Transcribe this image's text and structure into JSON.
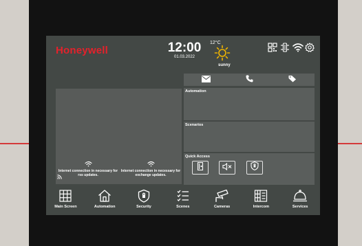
{
  "header": {
    "brand": "Honeywell",
    "time": "12:00",
    "date": "01.03.2022",
    "temperature": "12°C",
    "condition": "sunny",
    "status_icons": [
      "qr-code-icon",
      "network-icon",
      "wifi-icon",
      "settings-icon"
    ]
  },
  "rss": [
    {
      "message": "Internet connection in necessary for rss updates."
    },
    {
      "message": "Internet connection in necessary for exchange updates."
    }
  ],
  "comm_bar": [
    "mail-icon",
    "phone-icon",
    "tag-icon"
  ],
  "tiles": {
    "automation": "Automation",
    "scenarios": "Scenarios",
    "quick_access": "Quick Access",
    "quick_access_buttons": [
      "door-icon",
      "mute-icon",
      "alarm-shield-icon"
    ]
  },
  "nav": [
    {
      "label": "Main Screen",
      "icon": "grid-icon"
    },
    {
      "label": "Automation",
      "icon": "home-icon"
    },
    {
      "label": "Security",
      "icon": "shield-icon"
    },
    {
      "label": "Scenes",
      "icon": "list-icon"
    },
    {
      "label": "Cameras",
      "icon": "camera-icon"
    },
    {
      "label": "Intercom",
      "icon": "intercom-icon"
    },
    {
      "label": "Services",
      "icon": "bell-icon"
    }
  ],
  "colors": {
    "brand": "#e4212b",
    "screen_bg": "#434845",
    "tile_bg": "#5a5e5c",
    "sun": "#f0b400"
  }
}
